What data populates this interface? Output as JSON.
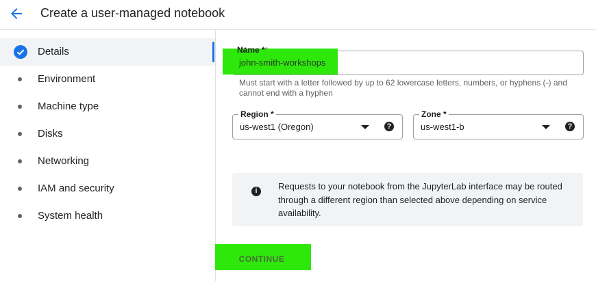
{
  "header": {
    "title": "Create a user-managed notebook"
  },
  "sidebar": {
    "items": [
      {
        "label": "Details"
      },
      {
        "label": "Environment"
      },
      {
        "label": "Machine type"
      },
      {
        "label": "Disks"
      },
      {
        "label": "Networking"
      },
      {
        "label": "IAM and security"
      },
      {
        "label": "System health"
      }
    ]
  },
  "form": {
    "name": {
      "label": "Name *",
      "value": "john-smith-workshops",
      "hint": "Must start with a letter followed by up to 62 lowercase letters, numbers, or hyphens (-) and cannot end with a hyphen"
    },
    "region": {
      "label": "Region *",
      "value": "us-west1 (Oregon)"
    },
    "zone": {
      "label": "Zone *",
      "value": "us-west1-b"
    },
    "help_glyph": "?"
  },
  "info": {
    "icon_glyph": "i",
    "text": "Requests to your notebook from the JupyterLab interface may be routed through a different region than selected above depending on service availability."
  },
  "actions": {
    "continue_label": "CONTINUE"
  },
  "colors": {
    "accent": "#1a73e8",
    "highlight": "#2ee80b",
    "sidebar_active": "#f1f3f4"
  },
  "icons": {
    "back": "arrow-back-icon",
    "check": "check-circle-icon",
    "caret": "dropdown-arrow-icon",
    "help": "help-icon",
    "info": "info-icon"
  }
}
